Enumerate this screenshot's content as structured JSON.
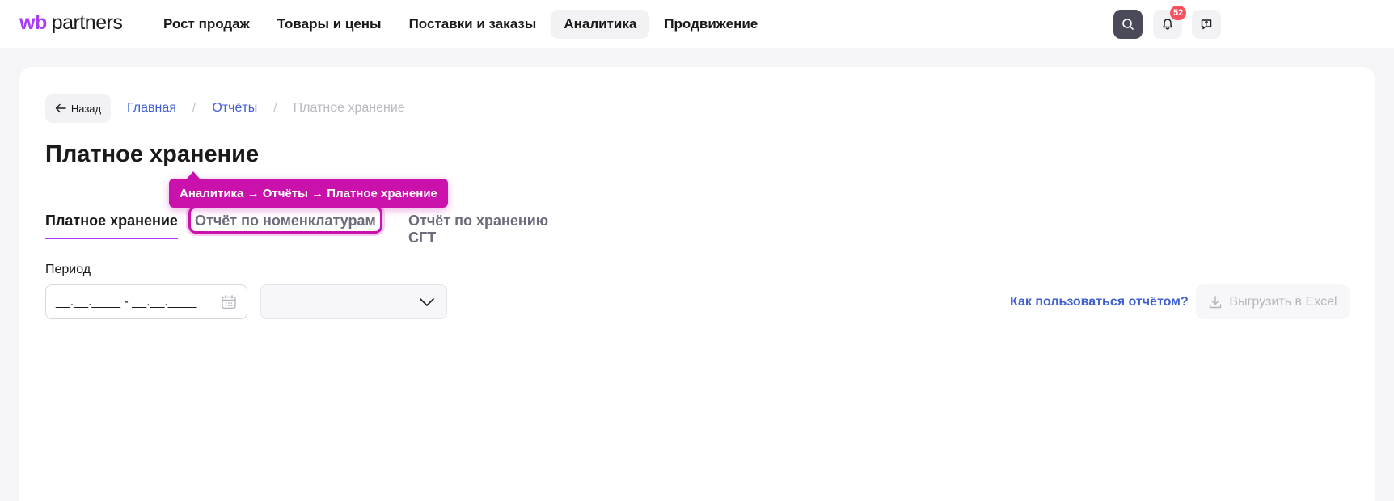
{
  "header": {
    "logo_wb": "wb",
    "logo_partners": "partners",
    "nav": [
      {
        "label": "Рост продаж"
      },
      {
        "label": "Товары и цены"
      },
      {
        "label": "Поставки и заказы"
      },
      {
        "label": "Аналитика"
      },
      {
        "label": "Продвижение"
      }
    ],
    "active_nav": "Аналитика",
    "notifications_count": "52"
  },
  "back_button": {
    "label": "Назад"
  },
  "breadcrumb": {
    "items": [
      "Главная",
      "Отчёты",
      "Платное хранение"
    ],
    "separator": "/"
  },
  "page_title": "Платное хранение",
  "tabs": [
    {
      "label": "Платное хранение",
      "active": true
    },
    {
      "label": "Отчёт по номенклатурам",
      "highlighted": true
    },
    {
      "label": "Отчёт по хранению СГТ"
    }
  ],
  "tooltip": {
    "text": "Аналитика → Отчёты → Платное хранение"
  },
  "filters": {
    "period_label": "Период",
    "period_placeholder": "__.__.____ - __.__.____",
    "select_value": ""
  },
  "actions": {
    "howto_label": "Как пользоваться отчётом?",
    "excel_label": "Выгрузить в Excel"
  },
  "colors": {
    "brand": "#a73afd",
    "highlight": "#cb11ab",
    "link": "#3f5fd3",
    "badge": "#f5515f"
  }
}
